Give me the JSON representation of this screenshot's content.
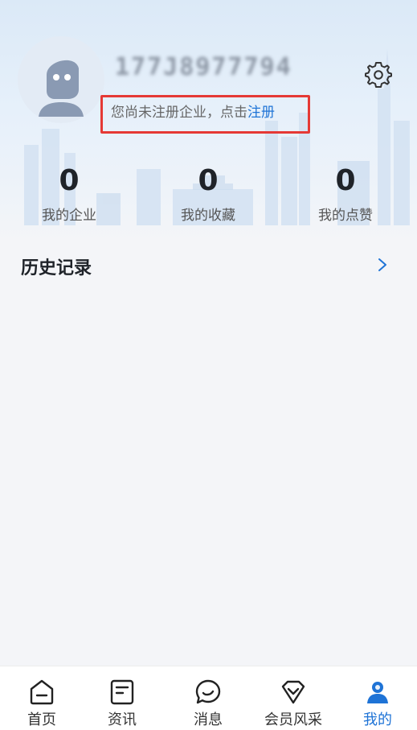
{
  "profile": {
    "username": "177J8977794",
    "register_prompt": "您尚未注册企业，点击",
    "register_link": "注册"
  },
  "stats": [
    {
      "value": "0",
      "label": "我的企业"
    },
    {
      "value": "0",
      "label": "我的收藏"
    },
    {
      "value": "0",
      "label": "我的点赞"
    }
  ],
  "history": {
    "title": "历史记录"
  },
  "tabbar": {
    "items": [
      {
        "label": "首页",
        "icon": "home-icon"
      },
      {
        "label": "资讯",
        "icon": "news-icon"
      },
      {
        "label": "消息",
        "icon": "message-icon"
      },
      {
        "label": "会员风采",
        "icon": "diamond-icon"
      },
      {
        "label": "我的",
        "icon": "profile-icon",
        "active": true
      }
    ]
  },
  "colors": {
    "accent": "#1e73d6",
    "highlight_border": "#e53935",
    "background": "#f4f5f8"
  }
}
